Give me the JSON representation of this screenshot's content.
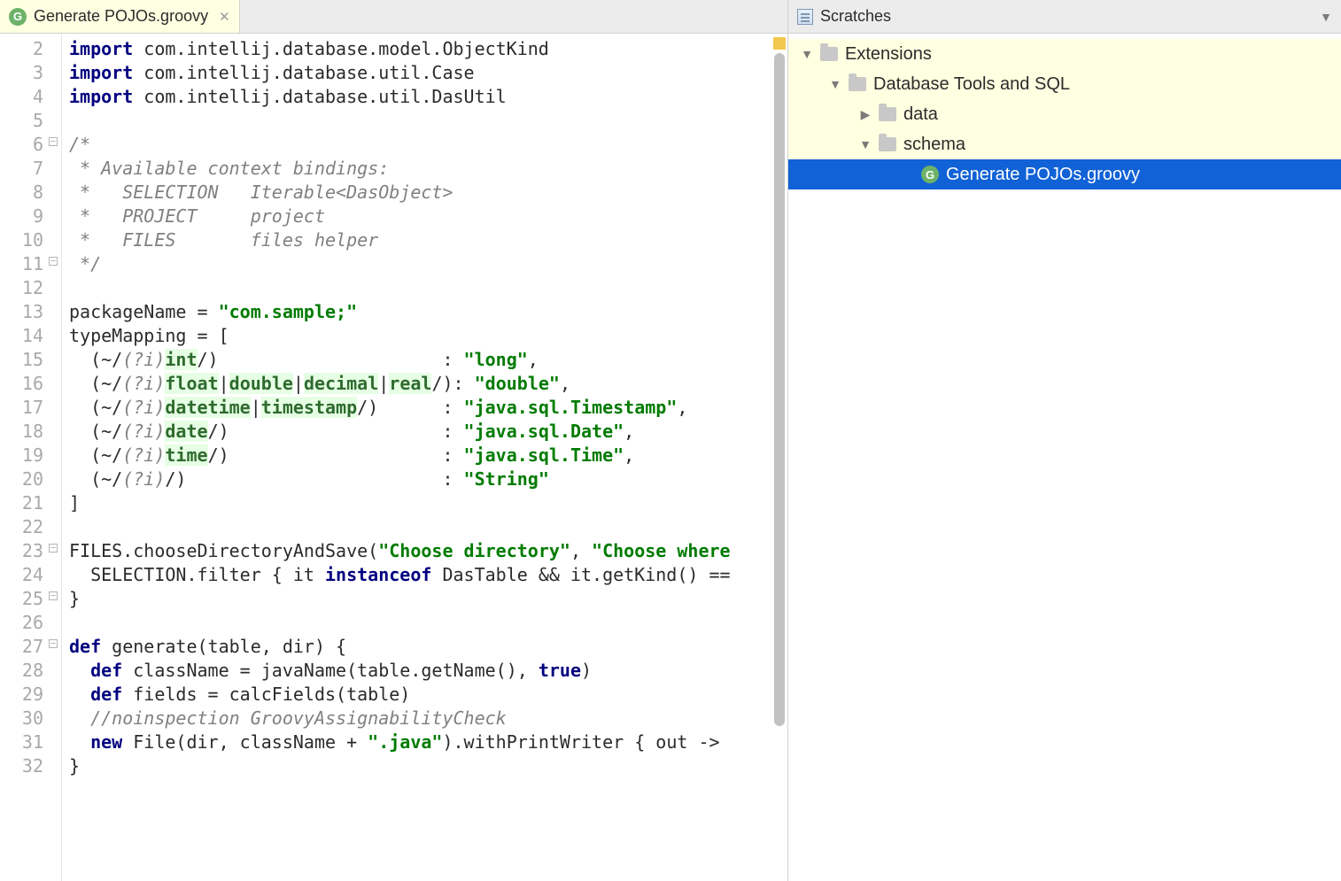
{
  "tab": {
    "file_icon_letter": "G",
    "title": "Generate POJOs.groovy"
  },
  "gutter": {
    "start": 2,
    "end": 32
  },
  "code_lines": [
    [
      [
        "kw",
        "import"
      ],
      [
        "",
        " com.intellij.database.model.ObjectKind"
      ]
    ],
    [
      [
        "kw",
        "import"
      ],
      [
        "",
        " com.intellij.database.util.Case"
      ]
    ],
    [
      [
        "kw",
        "import"
      ],
      [
        "",
        " com.intellij.database.util.DasUtil"
      ]
    ],
    [
      [
        "",
        ""
      ]
    ],
    [
      [
        "cm",
        "/*"
      ]
    ],
    [
      [
        "cm",
        " * Available context bindings:"
      ]
    ],
    [
      [
        "cm",
        " *   SELECTION   Iterable<DasObject>"
      ]
    ],
    [
      [
        "cm",
        " *   PROJECT     project"
      ]
    ],
    [
      [
        "cm",
        " *   FILES       files helper"
      ]
    ],
    [
      [
        "cm",
        " */"
      ]
    ],
    [
      [
        "",
        ""
      ]
    ],
    [
      [
        "",
        "packageName = "
      ],
      [
        "str",
        "\"com.sample;\""
      ]
    ],
    [
      [
        "",
        "typeMapping = ["
      ]
    ],
    [
      [
        "",
        "  (~/"
      ],
      [
        "cm",
        "(?i)"
      ],
      [
        "id-hl",
        "int"
      ],
      [
        "",
        "/)                     : "
      ],
      [
        "str",
        "\"long\""
      ],
      [
        "",
        ","
      ]
    ],
    [
      [
        "",
        "  (~/"
      ],
      [
        "cm",
        "(?i)"
      ],
      [
        "id-hl",
        "float"
      ],
      [
        "",
        "|"
      ],
      [
        "id-hl",
        "double"
      ],
      [
        "",
        "|"
      ],
      [
        "id-hl",
        "decimal"
      ],
      [
        "",
        "|"
      ],
      [
        "id-hl",
        "real"
      ],
      [
        "",
        "/): "
      ],
      [
        "str",
        "\"double\""
      ],
      [
        "",
        ","
      ]
    ],
    [
      [
        "",
        "  (~/"
      ],
      [
        "cm",
        "(?i)"
      ],
      [
        "id-hl",
        "datetime"
      ],
      [
        "",
        "|"
      ],
      [
        "id-hl",
        "timestamp"
      ],
      [
        "",
        "/)      : "
      ],
      [
        "str",
        "\"java.sql.Timestamp\""
      ],
      [
        "",
        ","
      ]
    ],
    [
      [
        "",
        "  (~/"
      ],
      [
        "cm",
        "(?i)"
      ],
      [
        "id-hl",
        "date"
      ],
      [
        "",
        "/)                    : "
      ],
      [
        "str",
        "\"java.sql.Date\""
      ],
      [
        "",
        ","
      ]
    ],
    [
      [
        "",
        "  (~/"
      ],
      [
        "cm",
        "(?i)"
      ],
      [
        "id-hl",
        "time"
      ],
      [
        "",
        "/)                    : "
      ],
      [
        "str",
        "\"java.sql.Time\""
      ],
      [
        "",
        ","
      ]
    ],
    [
      [
        "",
        "  (~/"
      ],
      [
        "cm",
        "(?i)"
      ],
      [
        "",
        "/)                        : "
      ],
      [
        "str",
        "\"String\""
      ]
    ],
    [
      [
        "",
        "]"
      ]
    ],
    [
      [
        "",
        ""
      ]
    ],
    [
      [
        "",
        "FILES.chooseDirectoryAndSave("
      ],
      [
        "str",
        "\"Choose directory\""
      ],
      [
        "",
        ", "
      ],
      [
        "str",
        "\"Choose where"
      ]
    ],
    [
      [
        "",
        "  SELECTION.filter { it "
      ],
      [
        "kw",
        "instanceof"
      ],
      [
        "",
        " DasTable && it.getKind() =="
      ]
    ],
    [
      [
        "",
        "}"
      ]
    ],
    [
      [
        "",
        ""
      ]
    ],
    [
      [
        "kw",
        "def"
      ],
      [
        "",
        " generate(table, dir) {"
      ]
    ],
    [
      [
        "",
        "  "
      ],
      [
        "kw",
        "def"
      ],
      [
        "",
        " className = javaName(table.getName(), "
      ],
      [
        "kw",
        "true"
      ],
      [
        "",
        ")"
      ]
    ],
    [
      [
        "",
        "  "
      ],
      [
        "kw",
        "def"
      ],
      [
        "",
        " fields = calcFields(table)"
      ]
    ],
    [
      [
        "",
        "  "
      ],
      [
        "cm",
        "//noinspection GroovyAssignabilityCheck"
      ]
    ],
    [
      [
        "",
        "  "
      ],
      [
        "kw",
        "new"
      ],
      [
        "",
        " File(dir, className + "
      ],
      [
        "str",
        "\".java\""
      ],
      [
        "",
        ").withPrintWriter { out ->"
      ]
    ],
    [
      [
        "",
        "}"
      ]
    ]
  ],
  "side": {
    "title": "Scratches",
    "tree": {
      "root": {
        "label": "Extensions"
      },
      "db": {
        "label": "Database Tools and SQL"
      },
      "data": {
        "label": "data"
      },
      "schema": {
        "label": "schema"
      },
      "file": {
        "icon_letter": "G",
        "label": "Generate POJOs.groovy"
      }
    }
  }
}
